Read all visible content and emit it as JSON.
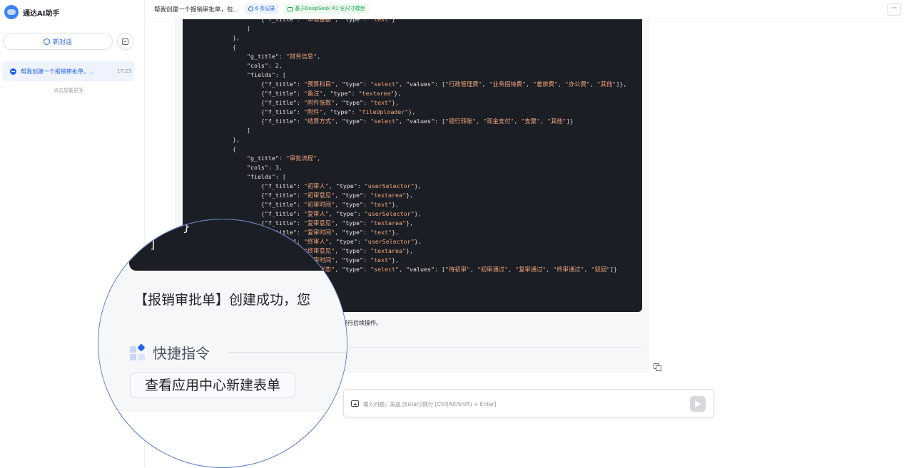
{
  "sidebar": {
    "app_name": "通达AI助手",
    "new_chat_label": "新对话",
    "conversations": [
      {
        "title": "帮我创建一个报销审批单，...",
        "time": "17:23"
      }
    ],
    "load_more": "点击加载更多"
  },
  "header": {
    "title": "帮我创建一个报销审批单，包...",
    "records_badge": "6 条记录",
    "model_badge": "基于DeepSeek R1 全尺寸模型",
    "more_label": "···"
  },
  "message": {
    "code_lines": [
      "                {\"f_title\": \"申请金额\", \"type\": \"text\"}",
      "            ]",
      "        },",
      "        {",
      "            \"g_title\": \"财务信息\",",
      "            \"cols\": 2,",
      "            \"fields\": [",
      "                {\"f_title\": \"预算科目\", \"type\": \"select\", \"values\": [\"行政管理费\", \"业务招待费\", \"差旅费\", \"办公费\", \"其他\"]},",
      "                {\"f_title\": \"备注\", \"type\": \"textarea\"},",
      "                {\"f_title\": \"附件张数\", \"type\": \"text\"},",
      "                {\"f_title\": \"附件\", \"type\": \"fileUploader\"},",
      "                {\"f_title\": \"结算方式\", \"type\": \"select\", \"values\": [\"银行转账\", \"现金支付\", \"支票\", \"其他\"]}",
      "            ]",
      "        },",
      "        {",
      "            \"g_title\": \"审批流程\",",
      "            \"cols\": 3,",
      "            \"fields\": [",
      "                {\"f_title\": \"初审人\", \"type\": \"userSelector\"},",
      "                {\"f_title\": \"初审意见\", \"type\": \"textarea\"},",
      "                {\"f_title\": \"初审时间\", \"type\": \"text\"},",
      "                {\"f_title\": \"复审人\", \"type\": \"userSelector\"},",
      "                {\"f_title\": \"复审意见\", \"type\": \"textarea\"},",
      "                {\"f_title\": \"复审时间\", \"type\": \"text\"},",
      "                {\"f_title\": \"终审人\", \"type\": \"userSelector\"},",
      "                {\"f_title\": \"终审意见\", \"type\": \"textarea\"},",
      "                {\"f_title\": \"终审时间\", \"type\": \"text\"},",
      "                {\"f_title\": \"审批状态\", \"type\": \"select\", \"values\": [\"待初审\", \"初审通过\", \"复审通过\", \"终审通过\", \"驳回\"]}",
      "            ]",
      "        }",
      "    ]",
      "}"
    ],
    "visible_tail_text": "续进行后续操作。",
    "magnified_success": "【报销审批单】创建成功，您",
    "quick_commands_label": "快捷指令",
    "quick_command_chip": "查看应用中心新建表单"
  },
  "input": {
    "placeholder": "输入问题，发送 [Enter]/换行 [Ctrl(Alt/Shift) + Enter]"
  },
  "colors": {
    "accent": "#2563eb",
    "code_bg": "#1b1e24",
    "string": "#f0a57c",
    "success_tag": "#16a34a"
  }
}
